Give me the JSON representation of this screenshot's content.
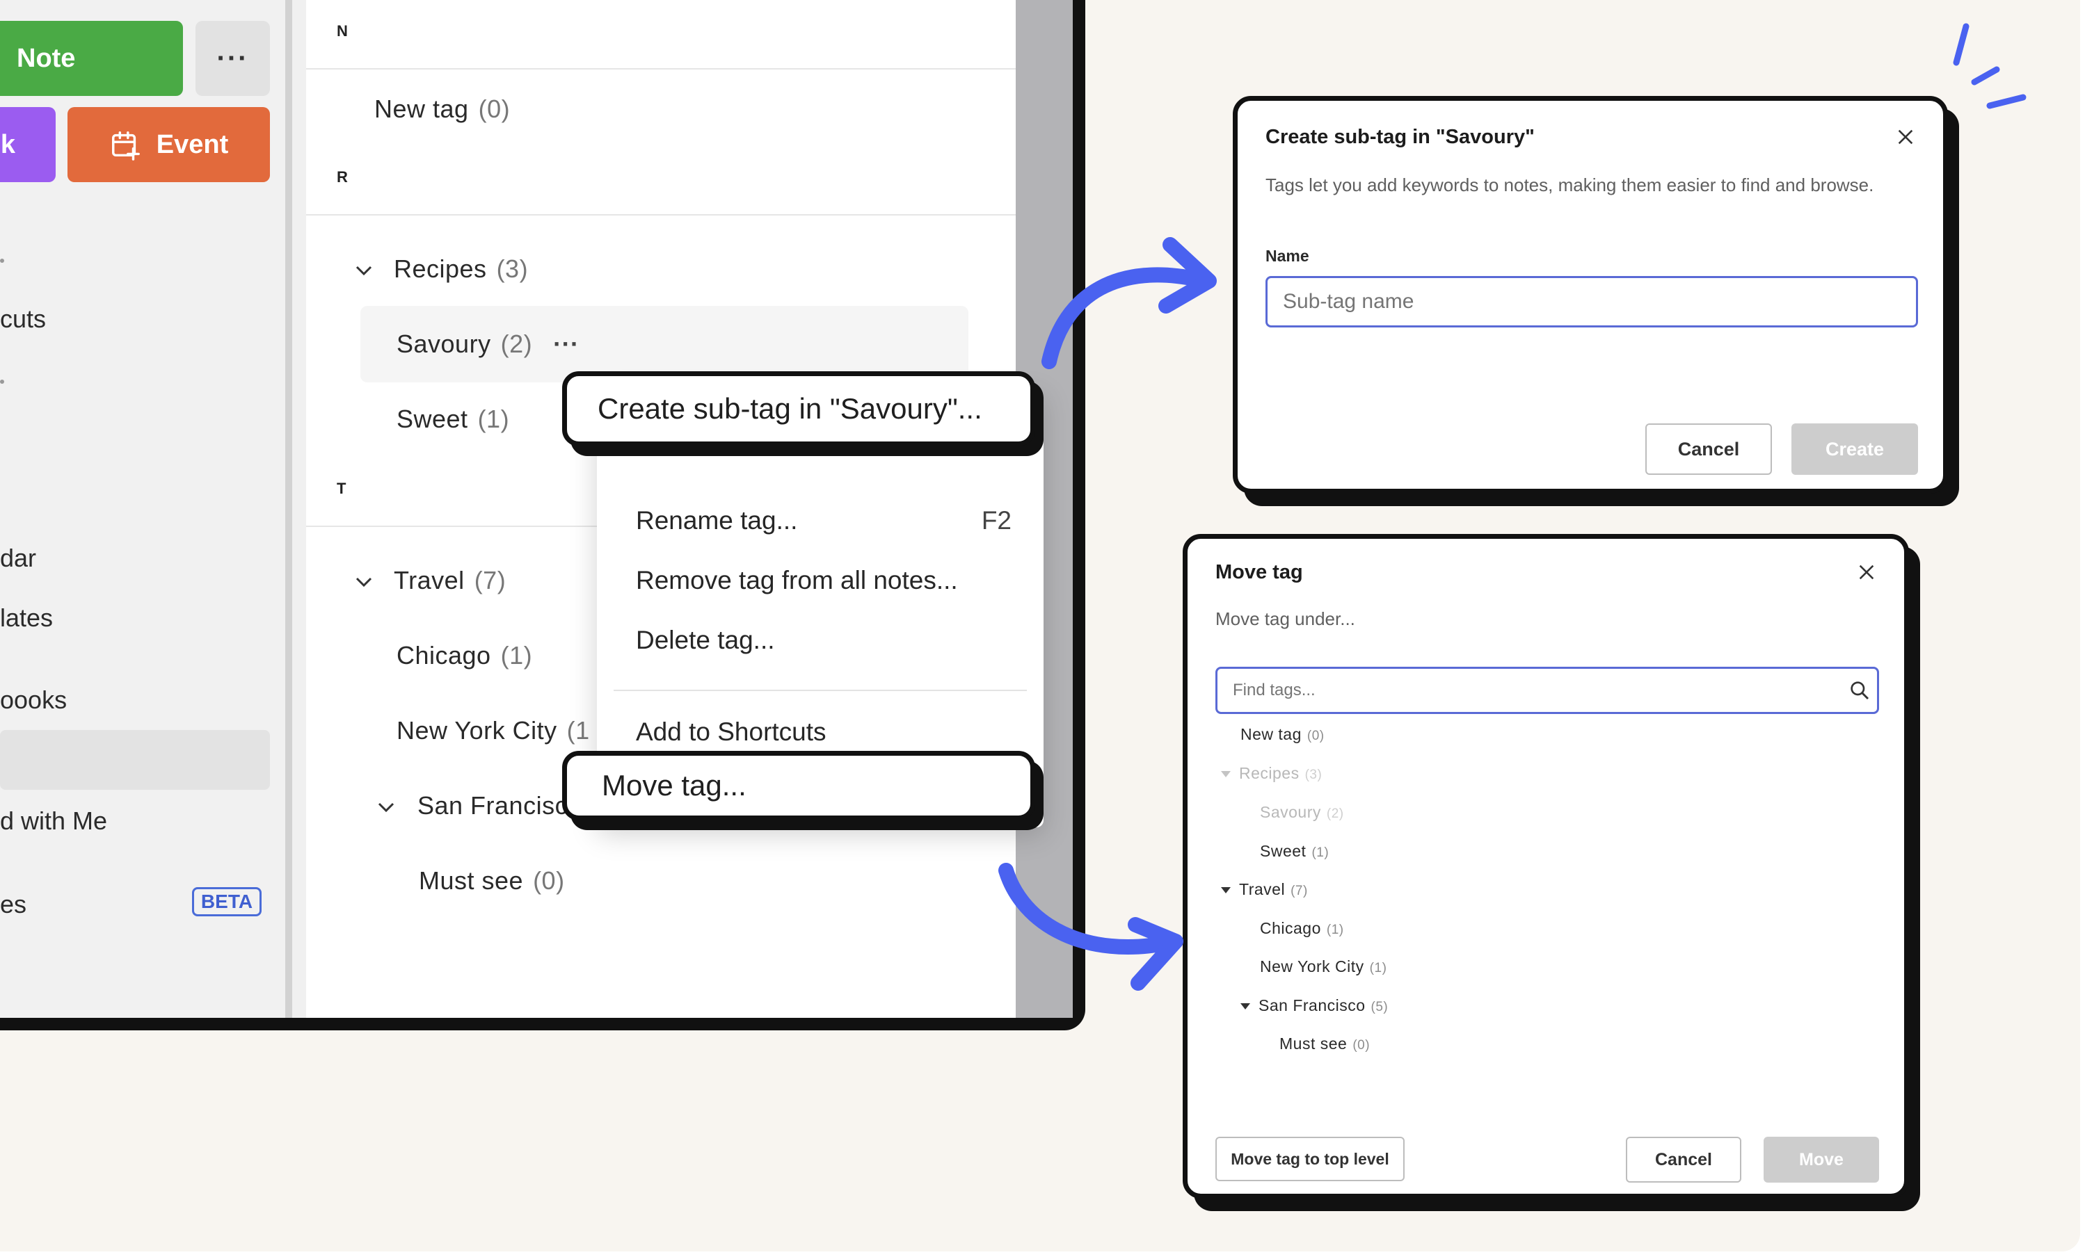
{
  "colors": {
    "note_green": "#4aaa45",
    "task_purple": "#9b5cf0",
    "event_orange": "#e26a3c",
    "accent_blue": "#4a62f0",
    "beta_blue": "#3f5fd0"
  },
  "sidebar": {
    "note_label": "Note",
    "more_label": "···",
    "task_label": "k",
    "event_label": "Event",
    "items": [
      {
        "label": "cuts"
      },
      {
        "label": "dar"
      },
      {
        "label": "lates"
      },
      {
        "label": "oooks"
      },
      {
        "label": "d with Me"
      },
      {
        "label": "es"
      }
    ],
    "beta_badge": "BETA"
  },
  "tags": {
    "sections": [
      {
        "letter": "N"
      },
      {
        "letter": "R"
      },
      {
        "letter": "T"
      }
    ],
    "rows": [
      {
        "name": "New tag",
        "count": "(0)"
      },
      {
        "name": "Recipes",
        "count": "(3)"
      },
      {
        "name": "Savoury",
        "count": "(2)"
      },
      {
        "name": "Sweet",
        "count": "(1)"
      },
      {
        "name": "Travel",
        "count": "(7)"
      },
      {
        "name": "Chicago",
        "count": "(1)"
      },
      {
        "name": "New York City",
        "count": "(1"
      },
      {
        "name": "San Francisc",
        "count": ""
      },
      {
        "name": "Must see",
        "count": "(0)"
      }
    ],
    "row_more": "···"
  },
  "context_menu": {
    "create_subtag": "Create sub-tag in \"Savoury\"...",
    "rename": "Rename tag...",
    "rename_shortcut": "F2",
    "remove": "Remove tag from all notes...",
    "delete": "Delete tag...",
    "add_shortcuts": "Add to Shortcuts",
    "move": "Move tag..."
  },
  "create_dialog": {
    "title": "Create sub-tag in \"Savoury\"",
    "description": "Tags let you add keywords to notes, making them easier to find and browse.",
    "name_label": "Name",
    "name_placeholder": "Sub-tag name",
    "cancel": "Cancel",
    "create": "Create"
  },
  "move_dialog": {
    "title": "Move tag",
    "subtitle": "Move tag under...",
    "search_placeholder": "Find tags...",
    "tree": [
      {
        "name": "New tag",
        "count": "(0)"
      },
      {
        "name": "Recipes",
        "count": "(3)"
      },
      {
        "name": "Savoury",
        "count": "(2)"
      },
      {
        "name": "Sweet",
        "count": "(1)"
      },
      {
        "name": "Travel",
        "count": "(7)"
      },
      {
        "name": "Chicago",
        "count": "(1)"
      },
      {
        "name": "New York City",
        "count": "(1)"
      },
      {
        "name": "San Francisco",
        "count": "(5)"
      },
      {
        "name": "Must see",
        "count": "(0)"
      }
    ],
    "top_level": "Move tag to top level",
    "cancel": "Cancel",
    "move": "Move"
  }
}
